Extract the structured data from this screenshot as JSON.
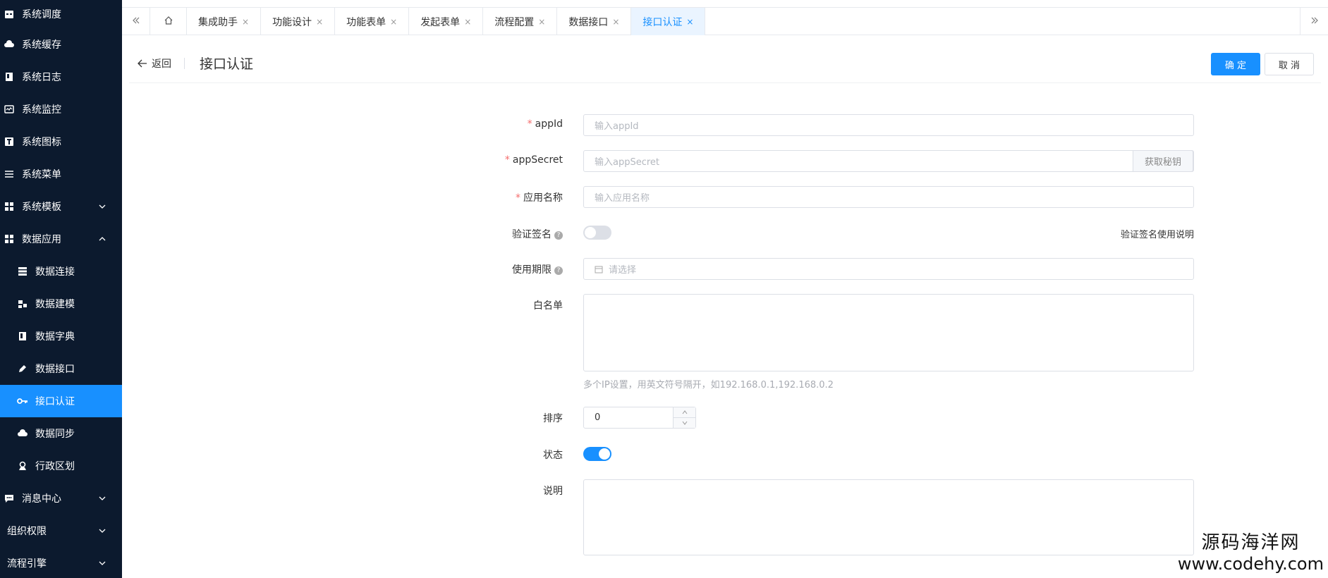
{
  "sidebar": {
    "items": [
      {
        "label": "系统调度",
        "icon": "calendar-icon",
        "level": 1
      },
      {
        "label": "系统缓存",
        "icon": "cloud-icon",
        "level": 1
      },
      {
        "label": "系统日志",
        "icon": "book-icon",
        "level": 1
      },
      {
        "label": "系统监控",
        "icon": "monitor-icon",
        "level": 1
      },
      {
        "label": "系统图标",
        "icon": "text-icon",
        "level": 1
      },
      {
        "label": "系统菜单",
        "icon": "menu-icon",
        "level": 1
      },
      {
        "label": "系统模板",
        "icon": "template-icon",
        "level": 1,
        "chevron": "down"
      },
      {
        "label": "数据应用",
        "icon": "apps-icon",
        "level": 1,
        "chevron": "up"
      },
      {
        "label": "数据连接",
        "icon": "database-icon",
        "level": 2
      },
      {
        "label": "数据建模",
        "icon": "model-icon",
        "level": 2
      },
      {
        "label": "数据字典",
        "icon": "dictionary-icon",
        "level": 2
      },
      {
        "label": "数据接口",
        "icon": "pen-icon",
        "level": 2
      },
      {
        "label": "接口认证",
        "icon": "key-icon",
        "level": 2,
        "active": true
      },
      {
        "label": "数据同步",
        "icon": "cloud-sync-icon",
        "level": 2
      },
      {
        "label": "行政区划",
        "icon": "location-icon",
        "level": 2
      },
      {
        "label": "消息中心",
        "icon": "message-icon",
        "level": 1,
        "chevron": "down"
      },
      {
        "label": "组织权限",
        "icon": "",
        "level": 1,
        "chevron": "down"
      },
      {
        "label": "流程引擎",
        "icon": "",
        "level": 1,
        "chevron": "down"
      }
    ]
  },
  "tabs": {
    "items": [
      {
        "label": "集成助手",
        "close": "×"
      },
      {
        "label": "功能设计",
        "close": "×"
      },
      {
        "label": "功能表单",
        "close": "×"
      },
      {
        "label": "发起表单",
        "close": "×"
      },
      {
        "label": "流程配置",
        "close": "×"
      },
      {
        "label": "数据接口",
        "close": "×"
      },
      {
        "label": "接口认证",
        "close": "×",
        "active": true
      }
    ]
  },
  "header": {
    "back_label": "返回",
    "title": "接口认证",
    "confirm_label": "确 定",
    "cancel_label": "取 消"
  },
  "form": {
    "appid": {
      "label": "appId",
      "placeholder": "输入appId"
    },
    "appsecret": {
      "label": "appSecret",
      "placeholder": "输入appSecret",
      "append": "获取秘钥"
    },
    "app_name": {
      "label": "应用名称",
      "placeholder": "输入应用名称"
    },
    "verify_sign": {
      "label": "验证签名",
      "enabled": false,
      "help_link": "验证签名使用说明"
    },
    "validity": {
      "label": "使用期限",
      "placeholder": "请选择"
    },
    "whitelist": {
      "label": "白名单",
      "hint": "多个IP设置，用英文符号隔开，如192.168.0.1,192.168.0.2"
    },
    "sort": {
      "label": "排序",
      "value": "0"
    },
    "status": {
      "label": "状态",
      "enabled": true
    },
    "description": {
      "label": "说明"
    }
  },
  "colors": {
    "primary": "#1890ff",
    "sidebar_bg": "#0c1a2e",
    "required": "#f56c6c"
  },
  "watermark": {
    "cn": "源码海洋网",
    "url": "www.codehy.com"
  }
}
